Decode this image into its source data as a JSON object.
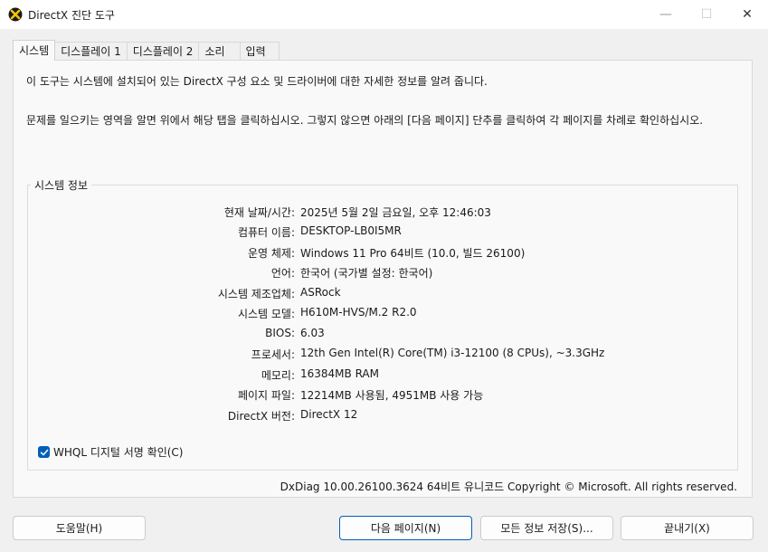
{
  "window": {
    "title": "DirectX 진단 도구",
    "min_label": "—",
    "max_label": "☐",
    "close_label": "✕"
  },
  "tabs": [
    "시스템",
    "디스플레이 1",
    "디스플레이 2",
    "소리",
    "입력"
  ],
  "intro": {
    "line1": "이 도구는 시스템에 설치되어 있는 DirectX 구성 요소 및 드라이버에 대한 자세한 정보를 알려 줍니다.",
    "line2": "문제를 일으키는 영역을 알면 위에서 해당 탭을 클릭하십시오. 그렇지 않으면 아래의 [다음 페이지] 단추를 클릭하여 각 페이지를 차례로 확인하십시오."
  },
  "system_info": {
    "title": "시스템 정보",
    "rows": [
      {
        "label": "현재 날짜/시간:",
        "value": "2025년 5월 2일 금요일, 오후 12:46:03"
      },
      {
        "label": "컴퓨터 이름:",
        "value": "DESKTOP-LB0I5MR"
      },
      {
        "label": "운영 체제:",
        "value": "Windows 11 Pro 64비트 (10.0, 빌드 26100)"
      },
      {
        "label": "언어:",
        "value": "한국어 (국가별 설정: 한국어)"
      },
      {
        "label": "시스템 제조업체:",
        "value": "ASRock"
      },
      {
        "label": "시스템 모델:",
        "value": "H610M-HVS/M.2 R2.0"
      },
      {
        "label": "BIOS:",
        "value": "6.03"
      },
      {
        "label": "프로세서:",
        "value": "12th Gen Intel(R) Core(TM) i3-12100 (8 CPUs), ~3.3GHz"
      },
      {
        "label": "메모리:",
        "value": "16384MB RAM"
      },
      {
        "label": "페이지 파일:",
        "value": "12214MB 사용됨, 4951MB 사용 가능"
      },
      {
        "label": "DirectX 버전:",
        "value": "DirectX 12"
      }
    ]
  },
  "whql": {
    "label": "WHQL 디지털 서명 확인(C)",
    "checked": true
  },
  "footer": "DxDiag 10.00.26100.3624 64비트 유니코드  Copyright © Microsoft. All rights reserved.",
  "buttons": {
    "help": "도움말(H)",
    "next": "다음 페이지(N)",
    "save": "모든 정보 저장(S)...",
    "exit": "끝내기(X)"
  },
  "colors": {
    "accent": "#005fb8",
    "app_icon_bg": "#1a1a1a",
    "app_icon_fg": "#f5c400"
  }
}
